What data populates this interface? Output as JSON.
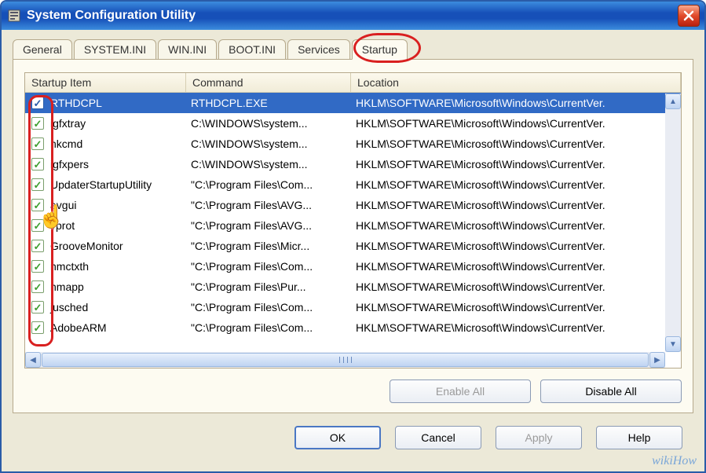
{
  "window": {
    "title": "System Configuration Utility"
  },
  "tabs": [
    "General",
    "SYSTEM.INI",
    "WIN.INI",
    "BOOT.INI",
    "Services",
    "Startup"
  ],
  "activeTab": "Startup",
  "columns": {
    "item": "Startup Item",
    "command": "Command",
    "location": "Location"
  },
  "rows": [
    {
      "checked": true,
      "selected": true,
      "item": "RTHDCPL",
      "command": "RTHDCPL.EXE",
      "location": "HKLM\\SOFTWARE\\Microsoft\\Windows\\CurrentVer."
    },
    {
      "checked": true,
      "item": "igfxtray",
      "command": "C:\\WINDOWS\\system...",
      "location": "HKLM\\SOFTWARE\\Microsoft\\Windows\\CurrentVer."
    },
    {
      "checked": true,
      "item": "hkcmd",
      "command": "C:\\WINDOWS\\system...",
      "location": "HKLM\\SOFTWARE\\Microsoft\\Windows\\CurrentVer."
    },
    {
      "checked": true,
      "item": "igfxpers",
      "command": "C:\\WINDOWS\\system...",
      "location": "HKLM\\SOFTWARE\\Microsoft\\Windows\\CurrentVer."
    },
    {
      "checked": true,
      "item": "UpdaterStartupUtility",
      "command": "\"C:\\Program Files\\Com...",
      "location": "HKLM\\SOFTWARE\\Microsoft\\Windows\\CurrentVer."
    },
    {
      "checked": true,
      "item": "avgui",
      "command": "\"C:\\Program Files\\AVG...",
      "location": "HKLM\\SOFTWARE\\Microsoft\\Windows\\CurrentVer."
    },
    {
      "checked": true,
      "item": "vprot",
      "command": "\"C:\\Program Files\\AVG...",
      "location": "HKLM\\SOFTWARE\\Microsoft\\Windows\\CurrentVer."
    },
    {
      "checked": true,
      "item": "GrooveMonitor",
      "command": "\"C:\\Program Files\\Micr...",
      "location": "HKLM\\SOFTWARE\\Microsoft\\Windows\\CurrentVer."
    },
    {
      "checked": true,
      "item": "nmctxth",
      "command": "\"C:\\Program Files\\Com...",
      "location": "HKLM\\SOFTWARE\\Microsoft\\Windows\\CurrentVer."
    },
    {
      "checked": true,
      "item": "nmapp",
      "command": "\"C:\\Program Files\\Pur...",
      "location": "HKLM\\SOFTWARE\\Microsoft\\Windows\\CurrentVer."
    },
    {
      "checked": true,
      "item": "jusched",
      "command": "\"C:\\Program Files\\Com...",
      "location": "HKLM\\SOFTWARE\\Microsoft\\Windows\\CurrentVer."
    },
    {
      "checked": true,
      "item": "AdobeARM",
      "command": "\"C:\\Program Files\\Com...",
      "location": "HKLM\\SOFTWARE\\Microsoft\\Windows\\CurrentVer."
    }
  ],
  "panelButtons": {
    "enableAll": "Enable All",
    "disableAll": "Disable All"
  },
  "dialogButtons": {
    "ok": "OK",
    "cancel": "Cancel",
    "apply": "Apply",
    "help": "Help"
  },
  "watermark": "wikiHow"
}
